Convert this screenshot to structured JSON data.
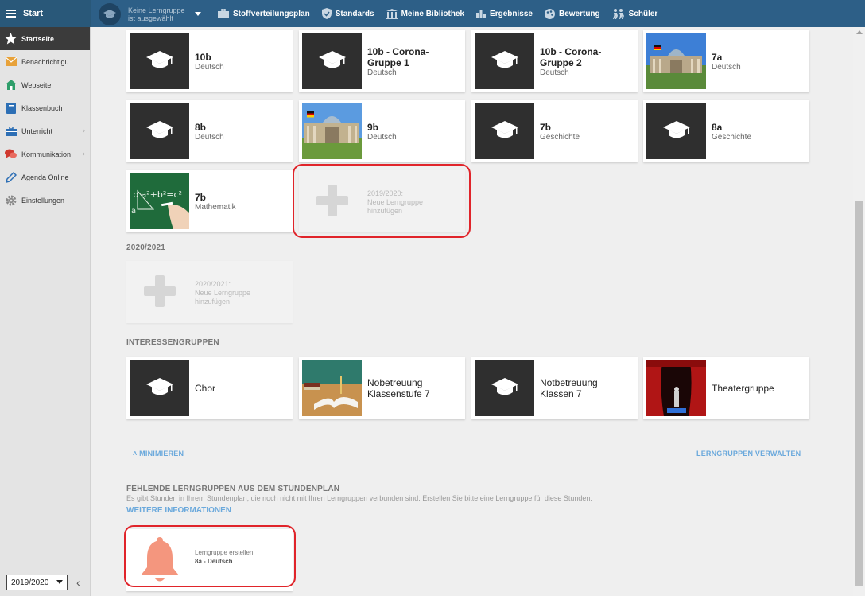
{
  "topbar": {
    "start_label": "Start",
    "group_selector": "Keine Lerngruppe ist ausgewählt",
    "nav": [
      {
        "label": "Stoffverteilungsplan",
        "icon": "briefcase-icon"
      },
      {
        "label": "Standards",
        "icon": "shield-check-icon"
      },
      {
        "label": "Meine Bibliothek",
        "icon": "library-icon"
      },
      {
        "label": "Ergebnisse",
        "icon": "bar-chart-icon"
      },
      {
        "label": "Bewertung",
        "icon": "palette-icon"
      },
      {
        "label": "Schüler",
        "icon": "students-icon"
      }
    ]
  },
  "sidebar": {
    "items": [
      {
        "label": "Startseite",
        "icon": "star-icon",
        "active": true
      },
      {
        "label": "Benachrichtigu...",
        "icon": "envelope-icon"
      },
      {
        "label": "Webseite",
        "icon": "house-icon"
      },
      {
        "label": "Klassenbuch",
        "icon": "book-icon"
      },
      {
        "label": "Unterricht",
        "icon": "briefcase-icon",
        "has_submenu": true
      },
      {
        "label": "Kommunikation",
        "icon": "chat-icon",
        "has_submenu": true
      },
      {
        "label": "Agenda Online",
        "icon": "pencil-icon"
      },
      {
        "label": "Einstellungen",
        "icon": "gear-icon"
      }
    ],
    "school_year": "2019/2020"
  },
  "groups_2019": [
    {
      "title": "10b",
      "subject": "Deutsch",
      "image": "graduation-cap"
    },
    {
      "title": "10b - Corona-Gruppe 1",
      "subject": "Deutsch",
      "image": "graduation-cap"
    },
    {
      "title": "10b - Corona-Gruppe 2",
      "subject": "Deutsch",
      "image": "graduation-cap"
    },
    {
      "title": "7a",
      "subject": "Deutsch",
      "image": "reichstag"
    },
    {
      "title": "8b",
      "subject": "Deutsch",
      "image": "graduation-cap"
    },
    {
      "title": "9b",
      "subject": "Deutsch",
      "image": "reichstag"
    },
    {
      "title": "7b",
      "subject": "Geschichte",
      "image": "graduation-cap"
    },
    {
      "title": "8a",
      "subject": "Geschichte",
      "image": "graduation-cap"
    },
    {
      "title": "7b",
      "subject": "Mathematik",
      "image": "chalkboard-math"
    }
  ],
  "add_2019": {
    "year": "2019/2020:",
    "label": "Neue Lerngruppe hinzufügen"
  },
  "section_2020": "2020/2021",
  "add_2020": {
    "year": "2020/2021:",
    "label": "Neue Lerngruppe hinzufügen"
  },
  "section_interest": "INTERESSENGRUPPEN",
  "interest_groups": [
    {
      "title": "Chor",
      "image": "graduation-cap"
    },
    {
      "title": "Nobetreuung Klassenstufe 7",
      "image": "books-classroom"
    },
    {
      "title": "Notbetreuung Klassen 7",
      "image": "graduation-cap"
    },
    {
      "title": "Theatergruppe",
      "image": "theater-stage"
    }
  ],
  "minimize_label": "MINIMIEREN",
  "manage_label": "LERNGRUPPEN VERWALTEN",
  "missing": {
    "title": "FEHLENDE LERNGRUPPEN AUS DEM STUNDENPLAN",
    "description": "Es gibt Stunden in Ihrem Stundenplan, die noch nicht mit Ihren Lerngruppen verbunden sind. Erstellen Sie bitte eine Lerngruppe für diese Stunden.",
    "more_info": "WEITERE INFORMATIONEN",
    "create_label": "Lerngruppe erstellen:",
    "create_group": "8a - Deutsch"
  },
  "colors": {
    "topbar": "#2d5f87",
    "accent_link": "#6ba9dc",
    "highlight": "#e0242a",
    "bell": "#f4967e"
  }
}
